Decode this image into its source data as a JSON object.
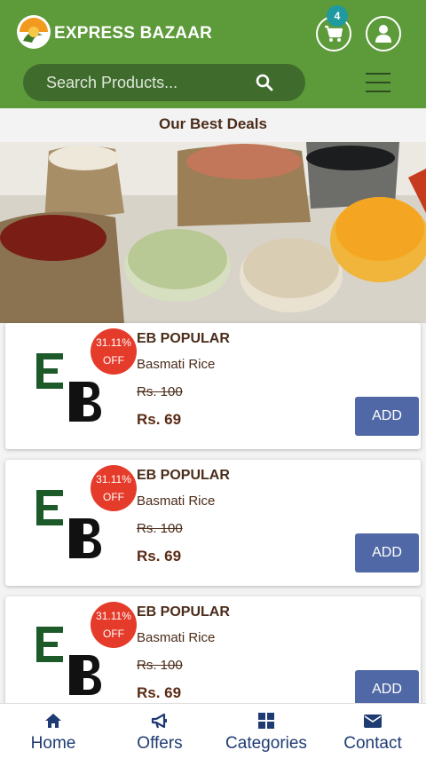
{
  "header": {
    "brand": "EXPRESS BAZAAR",
    "cart_count": "4",
    "search_placeholder": "Search Products..."
  },
  "section_title": "Our Best Deals",
  "carousel": {
    "dots": 4,
    "active": 0
  },
  "products": [
    {
      "badge_pct": "31.11%",
      "badge_off": "OFF",
      "brand": "EB POPULAR",
      "name": "Basmati Rice",
      "old_price": "Rs. 100",
      "new_price": "Rs. 69",
      "button": "ADD"
    },
    {
      "badge_pct": "31.11%",
      "badge_off": "OFF",
      "brand": "EB POPULAR",
      "name": "Basmati Rice",
      "old_price": "Rs. 100",
      "new_price": "Rs. 69",
      "button": "ADD"
    },
    {
      "badge_pct": "31.11%",
      "badge_off": "OFF",
      "brand": "EB POPULAR",
      "name": "Basmati Rice",
      "old_price": "Rs. 100",
      "new_price": "Rs. 69",
      "button": "ADD"
    }
  ],
  "nav": [
    {
      "label": "Home",
      "icon": "home-icon"
    },
    {
      "label": "Offers",
      "icon": "megaphone-icon"
    },
    {
      "label": "Categories",
      "icon": "grid-icon"
    },
    {
      "label": "Contact",
      "icon": "envelope-icon"
    }
  ],
  "colors": {
    "header": "#5c9a3a",
    "search": "#3f6b2c",
    "badge": "#e53b2a",
    "button": "#5068a5",
    "nav_text": "#1f3b73"
  }
}
